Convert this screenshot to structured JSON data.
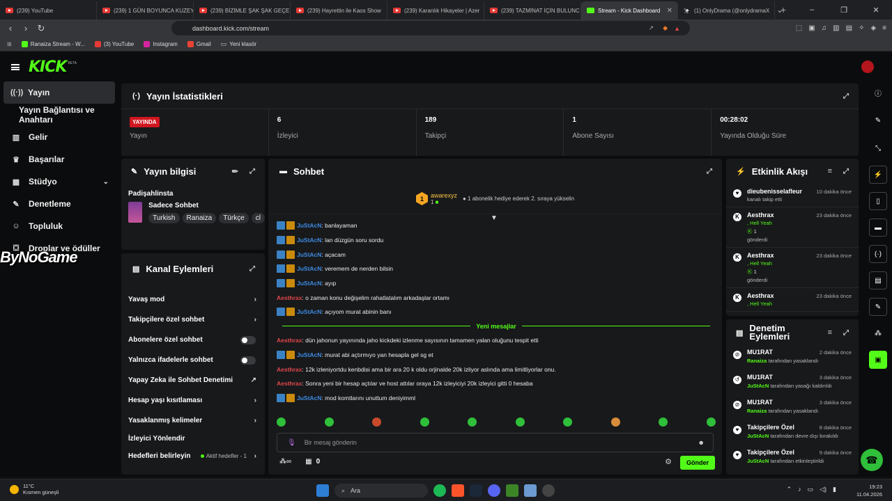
{
  "browser": {
    "tabs": [
      {
        "title": "(239) YouTube",
        "icon": "youtube"
      },
      {
        "title": "(239) 1 GÜN BOYUNCA KUZEY",
        "icon": "youtube"
      },
      {
        "title": "(239) BİZİMLE ŞAK ŞAK GEÇEN",
        "icon": "youtube"
      },
      {
        "title": "(239) Hayrettin ile Kaos Show",
        "icon": "youtube"
      },
      {
        "title": "(239) Karanlık Hikayeler | Azer",
        "icon": "youtube"
      },
      {
        "title": "(239) TAZMİNAT İÇİN BULUNC",
        "icon": "youtube"
      },
      {
        "title": "Stream - Kick Dashboard",
        "icon": "kick"
      },
      {
        "title": "(1) OnlyDrama (@onlydramaX",
        "icon": "x"
      }
    ],
    "url": "dashboard.kick.com/stream",
    "bookmarks": [
      "Ranaiza Stream - W...",
      "(3) YouTube",
      "Instagram",
      "Gmail",
      "Yeni klasör"
    ]
  },
  "brand": {
    "logo": "KICK",
    "beta": "BETA",
    "accent": "#53fc18"
  },
  "sidebar": {
    "items": [
      {
        "label": "Yayın",
        "icon": "broadcast-icon"
      },
      {
        "label": "Yayın Bağlantısı ve Anahtarı",
        "icon": ""
      },
      {
        "label": "Gelir",
        "icon": "chart-icon"
      },
      {
        "label": "Başarılar",
        "icon": "trophy-icon"
      },
      {
        "label": "Stüdyo",
        "icon": "studio-icon"
      },
      {
        "label": "Denetleme",
        "icon": "wrench-icon"
      },
      {
        "label": "Topluluk",
        "icon": "community-icon"
      },
      {
        "label": "Droplar ve ödüller",
        "icon": "gift-icon"
      }
    ]
  },
  "watermark": "ByNoGame",
  "stats": {
    "title": "Yayın İstatistikleri",
    "live_badge": "YAYINDA",
    "items": [
      {
        "value": "",
        "label": "Yayın"
      },
      {
        "value": "6",
        "label": "İzleyici"
      },
      {
        "value": "189",
        "label": "Takipçi"
      },
      {
        "value": "1",
        "label": "Abone Sayısı"
      },
      {
        "value": "00:28:02",
        "label": "Yayında Olduğu Süre"
      }
    ]
  },
  "stream_info": {
    "title": "Yayın bilgisi",
    "streamer": "Padişahlinsta",
    "category": "Sadece Sohbet",
    "tags": [
      "Turkish",
      "Ranaiza",
      "Türkçe",
      "cl"
    ]
  },
  "channel_actions": {
    "title": "Kanal Eylemleri",
    "items": [
      {
        "label": "Yavaş mod",
        "control": "chevron"
      },
      {
        "label": "Takipçilere özel sohbet",
        "control": "chevron"
      },
      {
        "label": "Abonelere özel sohbet",
        "control": "toggle"
      },
      {
        "label": "Yalnızca ifadelerle sohbet",
        "control": "toggle"
      },
      {
        "label": "Yapay Zeka ile Sohbet Denetimi",
        "control": "external"
      },
      {
        "label": "Hesap yaşı kısıtlaması",
        "control": "chevron"
      },
      {
        "label": "Yasaklanmış kelimeler",
        "control": "chevron"
      },
      {
        "label": "İzleyici Yönlendir",
        "control": "none"
      },
      {
        "label": "Hedefleri belirleyin",
        "control": "chevron"
      }
    ],
    "goal_status": "Aktif hedefler - 1"
  },
  "chat": {
    "title": "Sohbet",
    "pinned": {
      "badge": "1",
      "user": "awarexyz",
      "count": "1",
      "message": "1 abonelik hediye ederek 2. sıraya yükselin"
    },
    "messages_before": [
      {
        "user": "JuStAcN",
        "badges": true,
        "text": ": banlayaman"
      },
      {
        "user": "JuStAcN",
        "badges": true,
        "text": ": lan düzgün soru sordu"
      },
      {
        "user": "JuStAcN",
        "badges": true,
        "text": ": açacam"
      },
      {
        "user": "JuStAcN",
        "badges": true,
        "text": ": veremem de nerden bilsin"
      },
      {
        "user": "JuStAcN",
        "badges": true,
        "text": ": ayıp"
      },
      {
        "user": "Aesthrax",
        "badges": false,
        "text": ": o zaman konu değişelim rahatlatalım arkadaşlar ortamı"
      },
      {
        "user": "JuStAcN",
        "badges": true,
        "text": ": açıyom murat abinin banı"
      }
    ],
    "new_messages_label": "Yeni mesajlar",
    "messages_after": [
      {
        "user": "Aesthrax",
        "badges": false,
        "text": ": dün jahonun yayınında jaho kickdeki izlenme sayısının tamamen yalan oluğunu tespit etti"
      },
      {
        "user": "JuStAcN",
        "badges": true,
        "text": ": murat abi açtırmıyo yan hesapla gel sg et"
      },
      {
        "user": "Aesthrax",
        "badges": false,
        "text": ": 12k izleniyortdu kenbdisi ama bir ara 20 k oldu orjinalde 20k izliyor aslında ama limitliyorlar onu."
      },
      {
        "user": "Aesthrax",
        "badges": false,
        "text": ": Sonra yeni bir hesap açtılar ve host attılar oraya 12k izleyiciyi 20k izleyici gitti 0 hesaba"
      },
      {
        "user": "JuStAcN",
        "badges": true,
        "text": ": mod komtlarını unuttum deniyimml"
      }
    ],
    "input_placeholder": "Bir mesaj gönderin",
    "points": "0",
    "send_label": "Gönder"
  },
  "activity": {
    "title": "Etkinlik Akışı",
    "items": [
      {
        "user": "dieubenisselafleur",
        "time": "10 dakika önce",
        "line1": "kanalı takip etti",
        "gift": "",
        "count": "",
        "line3": ""
      },
      {
        "user": "Aesthrax",
        "time": "23 dakika önce",
        "line1": "",
        "gift": ", Hell Yeah",
        "count": "1",
        "line3": "gönderdi"
      },
      {
        "user": "Aesthrax",
        "time": "23 dakika önce",
        "line1": "",
        "gift": ", Hell Yeah",
        "count": "1",
        "line3": "gönderdi"
      },
      {
        "user": "Aesthrax",
        "time": "23 dakika önce",
        "line1": "",
        "gift": ", Hell Yeah",
        "count": "",
        "line3": ""
      }
    ]
  },
  "mod_actions": {
    "title": "Denetim Eylemleri",
    "items": [
      {
        "target": "MU1RAT",
        "time": "2 dakika önce",
        "actor": "Ranaiza",
        "action": " tarafından yasaklandı"
      },
      {
        "target": "MU1RAT",
        "time": "3 dakika önce",
        "actor": "JuStAcN",
        "action": " tarafından yasağı kaldırıldı"
      },
      {
        "target": "MU1RAT",
        "time": "3 dakika önce",
        "actor": "Ranaiza",
        "action": " tarafından yasaklandı"
      },
      {
        "target": "Takipçilere Özel",
        "time": "8 dakika önce",
        "actor": "JuStAcN",
        "action": " tarafından devre dışı bırakıldı"
      },
      {
        "target": "Takipçilere Özel",
        "time": "9 dakika önce",
        "actor": "JuStAcN",
        "action": " tarafından etkinleştirildi"
      }
    ]
  },
  "taskbar": {
    "temp": "11°C",
    "weather": "Kısmen güneşli",
    "search": "Ara",
    "time": "19:23",
    "date": "11.04.2026"
  }
}
